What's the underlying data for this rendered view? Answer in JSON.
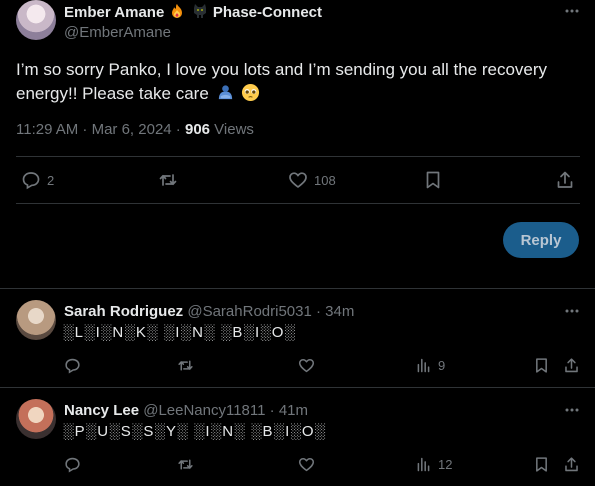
{
  "main_tweet": {
    "author_name": "Ember Amane",
    "author_suffix": "Phase-Connect",
    "author_handle": "@EmberAmane",
    "text_line1": "I’m so sorry Panko, I love you lots and I’m sending you all the recovery",
    "text_line2": "energy!! Please take care",
    "time": "11:29 AM · Mar 6, 2024 · ",
    "views_count": "906",
    "views_label": " Views",
    "replies": "2",
    "retweets": "",
    "likes": "108",
    "reply_button": "Reply"
  },
  "replies": [
    {
      "name": "Sarah Rodriguez",
      "handle": "@SarahRodri5031",
      "time": "· 34m",
      "text": "░L░I░N░K░ ░I░N░ ░B░I░O░",
      "views": "9"
    },
    {
      "name": "Nancy Lee",
      "handle": "@LeeNancy11811",
      "time": "· 41m",
      "text": "░P░U░S░S░Y░ ░I░N░ ░B░I░O░",
      "views": "12"
    }
  ],
  "colors": {
    "background": "#000000",
    "text": "#e7e9ea",
    "muted": "#71767b",
    "divider": "#2f3336",
    "reply_button": "#1b5d8c"
  },
  "icons": [
    "more-icon",
    "fire-emoji-icon",
    "cat-emoji-icon",
    "hug-emoji-icon",
    "pleading-face-emoji-icon",
    "reply-icon",
    "retweet-icon",
    "like-icon",
    "bookmark-icon",
    "share-icon",
    "analytics-icon"
  ]
}
